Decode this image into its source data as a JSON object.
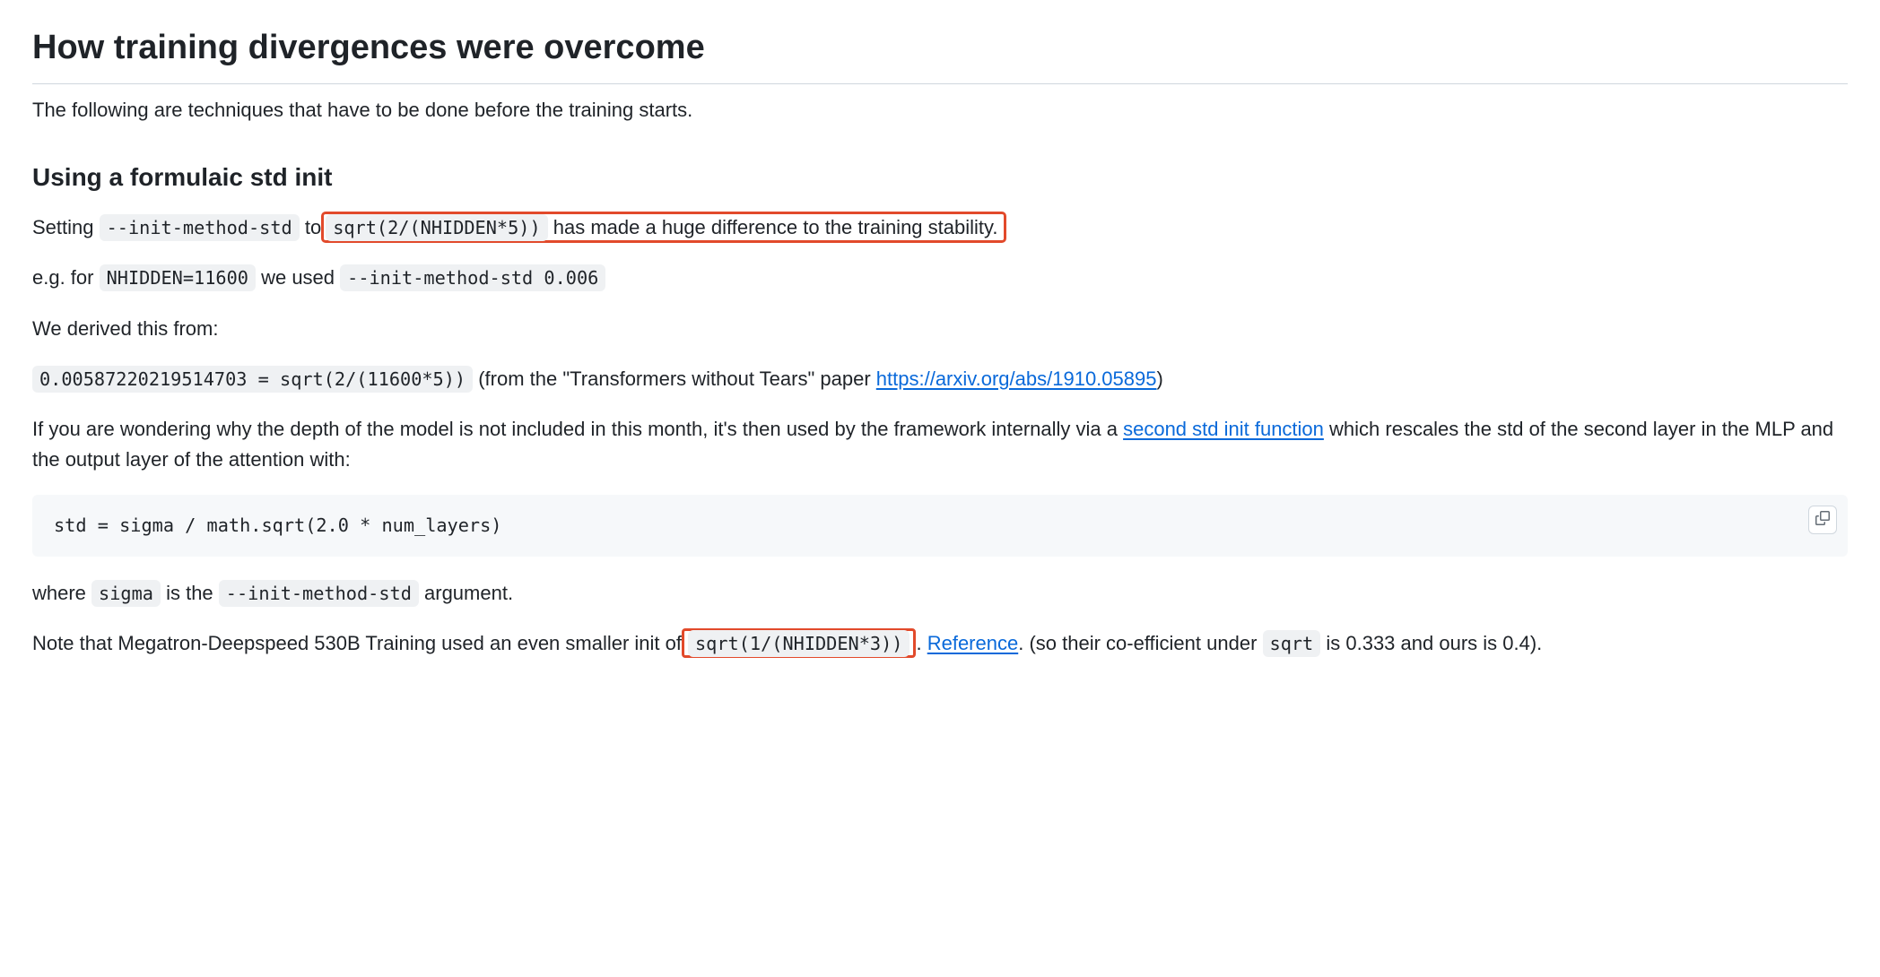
{
  "heading_main": "How training divergences were overcome",
  "intro_para": "The following are techniques that have to be done before the training starts.",
  "heading_sub": "Using a formulaic std init",
  "p1": {
    "t1": "Setting ",
    "code1": "--init-method-std",
    "t2": " to",
    "code2": "sqrt(2/(NHIDDEN*5))",
    "t3": " has made a huge difference to the training stability."
  },
  "p2": {
    "t1": "e.g. for ",
    "code1": "NHIDDEN=11600",
    "t2": " we used ",
    "code2": "--init-method-std 0.006"
  },
  "p3": "We derived this from:",
  "p4": {
    "code1": "0.00587220219514703 = sqrt(2/(11600*5))",
    "t1": " (from the \"Transformers without Tears\" paper ",
    "link1_text": "https://arxiv.org/abs/1910.05895",
    "t2": ")"
  },
  "p5": {
    "t1": "If you are wondering why the depth of the model is not included in this month, it's then used by the framework internally via a ",
    "link_text": "second std init function",
    "t2": " which rescales the std of the second layer in the MLP and the output layer of the attention with:"
  },
  "codeblock": "std = sigma / math.sqrt(2.0 * num_layers)",
  "p6": {
    "t1": "where ",
    "code1": "sigma",
    "t2": " is the ",
    "code2": "--init-method-std",
    "t3": " argument."
  },
  "p7": {
    "t1": "Note that Megatron-Deepspeed 530B Training used an even smaller init of",
    "code1": "sqrt(1/(NHIDDEN*3))",
    "t2": ". ",
    "link_text": "Reference",
    "t3": ". (so their co-efficient under ",
    "code2": "sqrt",
    "t4": " is 0.333 and ours is 0.4)."
  }
}
